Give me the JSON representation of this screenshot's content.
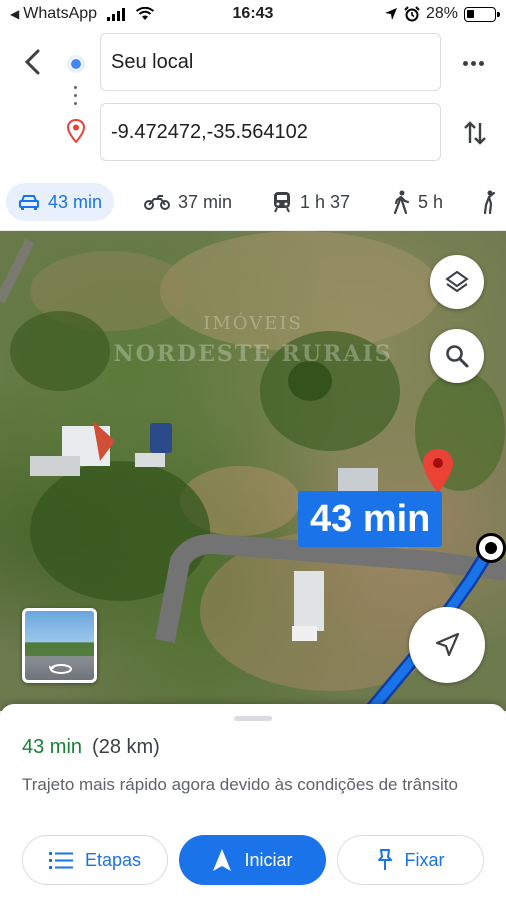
{
  "status_bar": {
    "back_app": "WhatsApp",
    "time": "16:43",
    "battery_percent": "28%",
    "battery_level": 0.28,
    "icons": [
      "back-triangle-icon",
      "signal-icon",
      "wifi-icon",
      "location-arrow-icon",
      "alarm-icon",
      "battery-icon"
    ]
  },
  "header": {
    "back_icon": "chevron-left-icon",
    "origin": {
      "value": "Seu local",
      "icon": "origin-dot-icon"
    },
    "destination": {
      "value": "-9.472472,-35.564102",
      "icon": "red-pin-icon"
    },
    "more_icon": "more-horiz-icon",
    "swap_icon": "swap-vertical-icon"
  },
  "modes": [
    {
      "icon": "car-icon",
      "label": "43 min",
      "active": true
    },
    {
      "icon": "motorcycle-icon",
      "label": "37 min",
      "active": false
    },
    {
      "icon": "transit-icon",
      "label": "1 h 37",
      "active": false
    },
    {
      "icon": "walk-icon",
      "label": "5 h",
      "active": false
    },
    {
      "icon": "rideshare-icon",
      "label": "",
      "active": false
    }
  ],
  "map": {
    "watermark_line1": "IMÓVEIS",
    "watermark_line2": "NORDESTE RURAIS",
    "route_time": "43 min",
    "route_color": "#1a73e8",
    "layers_icon": "layers-icon",
    "search_icon": "search-icon",
    "locate_icon": "navigation-arrow-icon",
    "streetview_icon": "360-rotate-icon"
  },
  "sheet": {
    "duration": "43 min",
    "distance": "(28 km)",
    "note": "Trajeto mais rápido agora devido às condições de trânsito",
    "buttons": {
      "steps": "Etapas",
      "start": "Iniciar",
      "pin": "Fixar"
    }
  },
  "colors": {
    "accent": "#1a73e8",
    "duration_green": "#188038",
    "pin_red": "#ea4335"
  }
}
